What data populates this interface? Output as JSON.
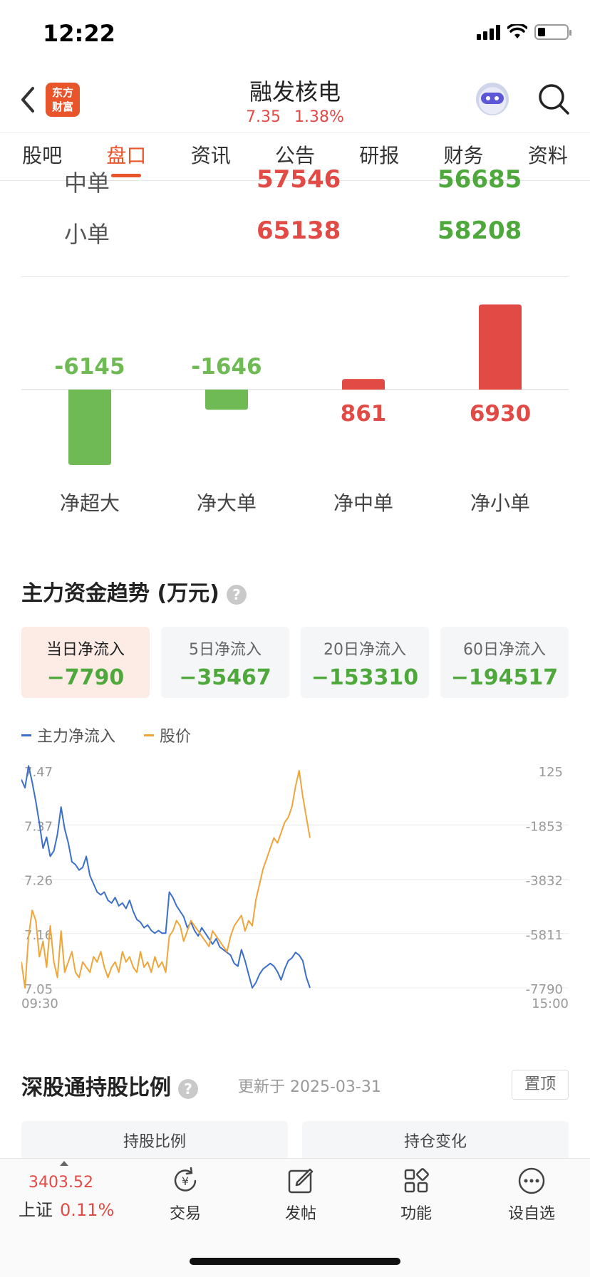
{
  "status_bar": {
    "time": "12:22"
  },
  "header": {
    "logo_line1": "东方",
    "logo_line2": "财富",
    "stock_name": "融发核电",
    "price": "7.35",
    "change_pct": "1.38%"
  },
  "tabs": [
    "股吧",
    "盘口",
    "资讯",
    "公告",
    "研报",
    "财务",
    "资料"
  ],
  "active_tab": "盘口",
  "order_table": {
    "rows": [
      {
        "label": "中单",
        "inflow": "57546",
        "outflow": "56685"
      },
      {
        "label": "小单",
        "inflow": "65138",
        "outflow": "58208"
      }
    ]
  },
  "net_flow_bars": {
    "categories": [
      "净超大",
      "净大单",
      "净中单",
      "净小单"
    ],
    "values": [
      -6145,
      -1646,
      861,
      6930
    ],
    "colors": {
      "positive": "#e24a45",
      "negative": "#6fba54"
    }
  },
  "trend_section": {
    "title": "主力资金趋势 (万元)",
    "help_icon": "?",
    "cards": [
      {
        "label": "当日净流入",
        "value": "−7790"
      },
      {
        "label": "5日净流入",
        "value": "−35467"
      },
      {
        "label": "20日净流入",
        "value": "−153310"
      },
      {
        "label": "60日净流入",
        "value": "−194517"
      }
    ],
    "legend": [
      {
        "name": "主力净流入",
        "color": "#3b6fc9"
      },
      {
        "name": "股价",
        "color": "#f0a53a"
      }
    ]
  },
  "chart_data": {
    "type": "line",
    "x_start_label": "09:30",
    "x_end_label": "15:00",
    "left_axis_ticks": [
      "7.47",
      "7.37",
      "7.26",
      "7.16",
      "7.05"
    ],
    "right_axis_ticks": [
      "125",
      "-1853",
      "-3832",
      "-5811",
      "-7790"
    ],
    "left_ylim": [
      7.05,
      7.47
    ],
    "right_ylim": [
      -7790,
      125
    ],
    "x_range": [
      0,
      240
    ],
    "series": [
      {
        "name": "主力净流入",
        "axis": "right",
        "color": "#3b6fc9",
        "x": [
          0,
          3,
          6,
          9,
          12,
          15,
          18,
          21,
          24,
          27,
          30,
          33,
          36,
          39,
          42,
          45,
          48,
          51,
          54,
          57,
          60,
          63,
          66,
          69,
          72,
          75,
          78,
          81,
          84,
          87,
          90,
          93,
          96,
          99,
          102,
          105,
          108,
          111,
          114,
          117,
          120,
          123,
          126,
          129,
          132,
          135,
          138,
          141,
          144,
          147,
          150,
          153,
          156,
          159,
          162,
          165,
          168,
          171,
          174,
          177,
          180,
          183,
          186,
          189,
          192,
          195,
          198,
          201,
          204,
          207,
          210,
          213,
          216,
          219,
          222,
          225,
          228,
          231,
          234,
          237,
          240
        ],
        "values": [
          -200,
          -500,
          300,
          -300,
          -1000,
          -1800,
          -2700,
          -2300,
          -3000,
          -2800,
          -2200,
          -1200,
          -2000,
          -2500,
          -3200,
          -3300,
          -3500,
          -3400,
          -3000,
          -3700,
          -4000,
          -4300,
          -4400,
          -4300,
          -4600,
          -4700,
          -4500,
          -4800,
          -4700,
          -4900,
          -4600,
          -5000,
          -5300,
          -5400,
          -5600,
          -5500,
          -5700,
          -5800,
          -5700,
          -5800,
          -5800,
          -4300,
          -4500,
          -4800,
          -5000,
          -5200,
          -5600,
          -5400,
          -5700,
          -5900,
          -5600,
          -5800,
          -6000,
          -6200,
          -6000,
          -6300,
          -6400,
          -6500,
          -6600,
          -6900,
          -7000,
          -6400,
          -6800,
          -7300,
          -7790,
          -7600,
          -7300,
          -7100,
          -7000,
          -6900,
          -7000,
          -7200,
          -7500,
          -7100,
          -6800,
          -6700,
          -6500,
          -6600,
          -6800,
          -7400,
          -7790
        ]
      },
      {
        "name": "股价",
        "axis": "left",
        "color": "#f0a53a",
        "x": [
          0,
          3,
          6,
          9,
          12,
          15,
          18,
          21,
          24,
          27,
          30,
          33,
          36,
          39,
          42,
          45,
          48,
          51,
          54,
          57,
          60,
          63,
          66,
          69,
          72,
          75,
          78,
          81,
          84,
          87,
          90,
          93,
          96,
          99,
          102,
          105,
          108,
          111,
          114,
          117,
          120,
          123,
          126,
          129,
          132,
          135,
          138,
          141,
          144,
          147,
          150,
          153,
          156,
          159,
          162,
          165,
          168,
          171,
          174,
          177,
          180,
          183,
          186,
          189,
          192,
          195,
          198,
          201,
          204,
          207,
          210,
          213,
          216,
          219,
          222,
          225,
          228,
          231,
          234,
          237,
          240
        ],
        "values": [
          7.1,
          7.05,
          7.15,
          7.2,
          7.18,
          7.11,
          7.14,
          7.09,
          7.17,
          7.1,
          7.07,
          7.16,
          7.08,
          7.1,
          7.12,
          7.08,
          7.07,
          7.1,
          7.09,
          7.08,
          7.11,
          7.1,
          7.12,
          7.09,
          7.07,
          7.09,
          7.1,
          7.08,
          7.12,
          7.1,
          7.11,
          7.09,
          7.08,
          7.12,
          7.09,
          7.1,
          7.08,
          7.11,
          7.09,
          7.1,
          7.08,
          7.15,
          7.16,
          7.18,
          7.17,
          7.14,
          7.16,
          7.18,
          7.17,
          7.16,
          7.15,
          7.14,
          7.13,
          7.16,
          7.15,
          7.14,
          7.13,
          7.12,
          7.15,
          7.17,
          7.18,
          7.19,
          7.16,
          7.18,
          7.17,
          7.22,
          7.25,
          7.28,
          7.3,
          7.32,
          7.34,
          7.33,
          7.35,
          7.37,
          7.38,
          7.4,
          7.44,
          7.47,
          7.42,
          7.38,
          7.34
        ]
      }
    ]
  },
  "sgt_section": {
    "title": "深股通持股比例",
    "updated": "更新于 2025-03-31",
    "pin_label": "置顶",
    "col1": "持股比例",
    "col2": "持仓变化"
  },
  "bottom_bar": {
    "index_value": "3403.52",
    "index_name": "上证",
    "index_change": "0.11%",
    "items": [
      {
        "label": "交易",
        "icon": "trade-icon"
      },
      {
        "label": "发帖",
        "icon": "post-icon"
      },
      {
        "label": "功能",
        "icon": "function-icon"
      },
      {
        "label": "设自选",
        "icon": "more-icon"
      }
    ]
  }
}
